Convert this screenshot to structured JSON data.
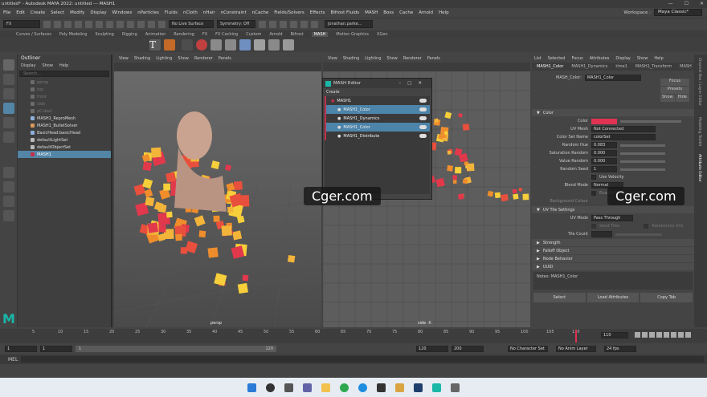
{
  "window": {
    "title": "untitled* - Autodesk MAYA 2022: untitled  ---  MASH1",
    "controls": [
      "—",
      "☐",
      "✕"
    ]
  },
  "menubar": {
    "items": [
      "File",
      "Edit",
      "Create",
      "Select",
      "Modify",
      "Display",
      "Windows",
      "nParticles",
      "Fluids",
      "nCloth",
      "nHair",
      "nConstraint",
      "nCache",
      "Fields/Solvers",
      "Effects",
      "Bifrost Fluids",
      "MASH",
      "Boss",
      "Cache",
      "Arnold",
      "Help"
    ],
    "workspace_label": "Workspace :",
    "workspace_value": "Maya Classic*"
  },
  "statusline": {
    "mode": "FX",
    "live_surface": "No Live Surface",
    "symmetry": "Symmetry: Off",
    "user": "jonathan.parke..."
  },
  "shelf": {
    "tabs": [
      "Curves / Surfaces",
      "Poly Modeling",
      "Sculpting",
      "Rigging",
      "Animation",
      "Rendering",
      "FX",
      "FX Caching",
      "Custom",
      "Arnold",
      "Bifrost",
      "MASH",
      "Motion Graphics",
      "XGen"
    ],
    "active_tab": "MASH"
  },
  "outliner": {
    "title": "Outliner",
    "menu": [
      "Display",
      "Show",
      "Help"
    ],
    "search_placeholder": "Search...",
    "items": [
      {
        "label": "persp",
        "dim": true,
        "color": "#6b6b6b"
      },
      {
        "label": "top",
        "dim": true,
        "color": "#6b6b6b"
      },
      {
        "label": "front",
        "dim": true,
        "color": "#6b6b6b"
      },
      {
        "label": "side",
        "dim": true,
        "color": "#6b6b6b"
      },
      {
        "label": "pCube1",
        "dim": true,
        "color": "#6b6b6b"
      },
      {
        "label": "MASH1_ReproMesh",
        "dim": false,
        "color": "#8fb0d9"
      },
      {
        "label": "MASH1_BulletSolver",
        "dim": false,
        "color": "#d99a5b"
      },
      {
        "label": "BasicHead:basicHead",
        "dim": false,
        "color": "#8fb0d9"
      },
      {
        "label": "defaultLightSet",
        "dim": false,
        "color": "#b9b9b9"
      },
      {
        "label": "defaultObjectSet",
        "dim": false,
        "color": "#b9b9b9"
      },
      {
        "label": "MASH1",
        "dim": false,
        "color": "#c0314b",
        "selected": true
      }
    ]
  },
  "viewport_menu": [
    "View",
    "Shading",
    "Lighting",
    "Show",
    "Renderer",
    "Panels"
  ],
  "viewport_left": {
    "camera": "persp"
  },
  "viewport_right": {
    "camera": "side -X"
  },
  "mash_editor": {
    "title": "MASH Editor",
    "create_label": "Create",
    "nodes": [
      {
        "label": "MASH1",
        "style": "plain"
      },
      {
        "label": "MASH1_Color",
        "style": "blue"
      },
      {
        "label": "MASH1_Dynamics",
        "style": "plain"
      },
      {
        "label": "MASH1_Color",
        "style": "blue"
      },
      {
        "label": "MASH1_Distribute",
        "style": "plain"
      }
    ]
  },
  "attribute_editor": {
    "menu": [
      "List",
      "Selected",
      "Focus",
      "Attributes",
      "Display",
      "Show",
      "Help"
    ],
    "tabs": [
      "MASH1_Color",
      "MASH1_Dynamics",
      "time1",
      "MASH1_Transform",
      "MASH"
    ],
    "node_label": "MASH_Color:",
    "node_value": "MASH1_Color",
    "side_buttons": [
      "Focus",
      "Presets"
    ],
    "show_hide": [
      "Show",
      "Hide"
    ],
    "section_color": "Color",
    "color_label": "Color",
    "color_swatch": "#e03352",
    "rows": [
      {
        "label": "UV Mesh",
        "value": "Not Connected"
      },
      {
        "label": "Color Set Name",
        "value": "colorSet"
      },
      {
        "label": "Random Hue",
        "value": "0.083"
      },
      {
        "label": "Saturation Random",
        "value": "0.000"
      },
      {
        "label": "Value Random",
        "value": "0.000"
      },
      {
        "label": "Random Seed",
        "value": "1"
      }
    ],
    "use_velocity": "Use Velocity",
    "blend_mode_label": "Blend Mode",
    "blend_mode_value": "Normal",
    "enable_background": "Enable Background",
    "background_colour": "Background Colour",
    "uv_settings": "UV Tile Settings",
    "uv_mode_label": "UV Mode",
    "uv_mode_value": "Pass Through",
    "seed_tiles": "Seed Tiles",
    "randomize_uvs": "Randomize UVs",
    "tile_count": "Tile Count",
    "collapsed_sections": [
      "Strength",
      "Falloff Object",
      "Node Behavior",
      "UUID"
    ],
    "notes": "Notes:  MASH1_Color",
    "bottom_buttons": [
      "Select",
      "Load Attributes",
      "Copy Tab"
    ]
  },
  "side_tabs": [
    "Channel Box / Layer Editor",
    "Modeling Toolkit",
    "Attribute Editor"
  ],
  "timeline": {
    "ticks": [
      "5",
      "10",
      "15",
      "20",
      "25",
      "30",
      "35",
      "40",
      "45",
      "50",
      "55",
      "60",
      "65",
      "70",
      "75",
      "80",
      "85",
      "90",
      "95",
      "100",
      "105",
      "110"
    ],
    "current_frame": "110"
  },
  "range": {
    "start": "1",
    "start2": "1",
    "slider_start": "1",
    "slider_end": "120",
    "end": "120",
    "end2": "200",
    "character_set": "No Character Set",
    "anim_layer": "No Anim Layer",
    "fps": "24 fps"
  },
  "cmdline": {
    "lang": "MEL"
  },
  "watermark": "Cger.com",
  "maya_logo": "M"
}
